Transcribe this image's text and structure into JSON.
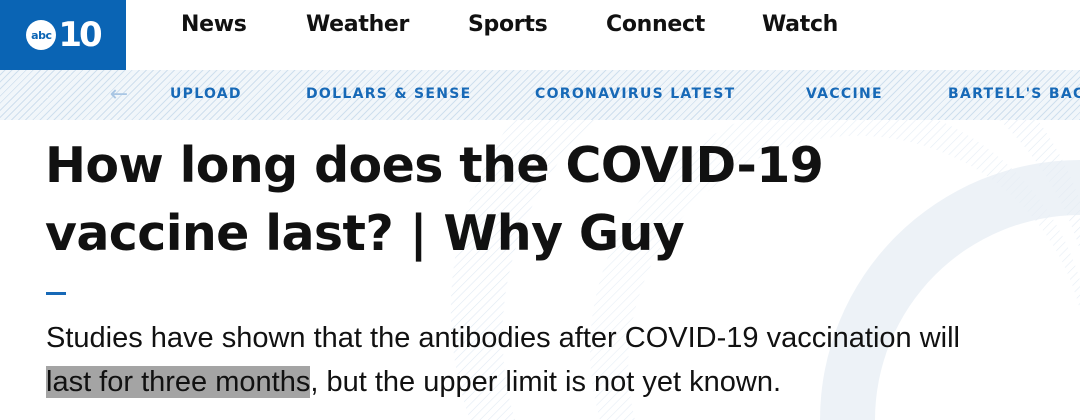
{
  "logo": {
    "mark": "abc",
    "number": "10"
  },
  "main_nav": [
    {
      "label": "News"
    },
    {
      "label": "Weather"
    },
    {
      "label": "Sports"
    },
    {
      "label": "Connect"
    },
    {
      "label": "Watch"
    }
  ],
  "sub_nav": {
    "back_icon": "arrow-left-icon",
    "items": [
      {
        "label": "UPLOAD"
      },
      {
        "label": "DOLLARS & SENSE"
      },
      {
        "label": "CORONAVIRUS LATEST"
      },
      {
        "label": "VACCINE"
      },
      {
        "label": "BARTELL'S BAC"
      }
    ]
  },
  "article": {
    "headline_line1": "How long does the COVID-19",
    "headline_line2": "vaccine last? | Why Guy",
    "summary_line1": "Studies have shown that the antibodies after COVID-19 vaccination will",
    "summary_highlight": "last for three months",
    "summary_rest": ", but the upper limit is not yet known."
  },
  "colors": {
    "brand_blue": "#0a64b4",
    "link_blue": "#1769b7",
    "highlight_gray": "#a4a4a4"
  }
}
